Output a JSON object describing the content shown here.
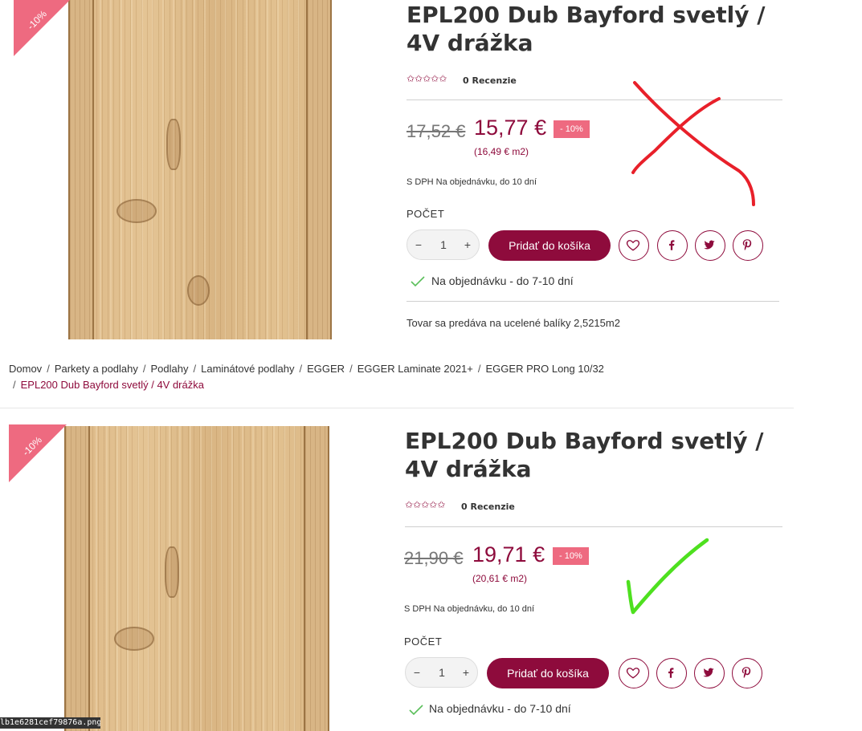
{
  "top": {
    "discount_ribbon": "-10%",
    "title": "EPL200 Dub Bayford svetlý / 4V drážka",
    "rating_stars": "✩✩✩✩✩",
    "reviews": "0 Recenzie",
    "old_price": "17,52 €",
    "new_price": "15,77 €",
    "discount_badge": "- 10%",
    "unit_price": "(16,49 € m2)",
    "dph_text": "S DPH Na objednávku, do 10 dní",
    "qty_label": "POČET",
    "qty_minus": "−",
    "qty_value": "1",
    "qty_plus": "+",
    "add_to_cart": "Pridať do košíka",
    "availability": "Na objednávku - do 7-10 dní",
    "package_note": "Tovar sa predáva na ucelené balíky 2,5215m2",
    "annotation_mark": "red-cross"
  },
  "breadcrumb": {
    "items": [
      "Domov",
      "Parkety a podlahy",
      "Podlahy",
      "Laminátové podlahy",
      "EGGER",
      "EGGER Laminate 2021+",
      "EGGER PRO Long 10/32"
    ],
    "current": "EPL200 Dub Bayford svetlý / 4V drážka",
    "separator": "/"
  },
  "bottom": {
    "discount_ribbon": "-10%",
    "title": "EPL200 Dub Bayford svetlý / 4V drážka",
    "rating_stars": "✩✩✩✩✩",
    "reviews": "0 Recenzie",
    "old_price": "21,90 €",
    "new_price": "19,71 €",
    "discount_badge": "- 10%",
    "unit_price": "(20,61 € m2)",
    "dph_text": "S DPH Na objednávku, do 10 dní",
    "qty_label": "POČET",
    "qty_minus": "−",
    "qty_value": "1",
    "qty_plus": "+",
    "add_to_cart": "Pridať do košíka",
    "availability": "Na objednávku - do 7-10 dní",
    "annotation_mark": "green-check"
  },
  "filename": "lb1e6281cef79876a.png",
  "colors": {
    "brand": "#8e0b3c",
    "badge": "#ee6a80",
    "annotation_red": "#e8202a",
    "annotation_green": "#4ee01f",
    "availability_check": "#5bbf5b"
  },
  "icons": [
    "heart-icon",
    "facebook-icon",
    "twitter-icon",
    "pinterest-icon",
    "check-icon",
    "star-icon"
  ]
}
